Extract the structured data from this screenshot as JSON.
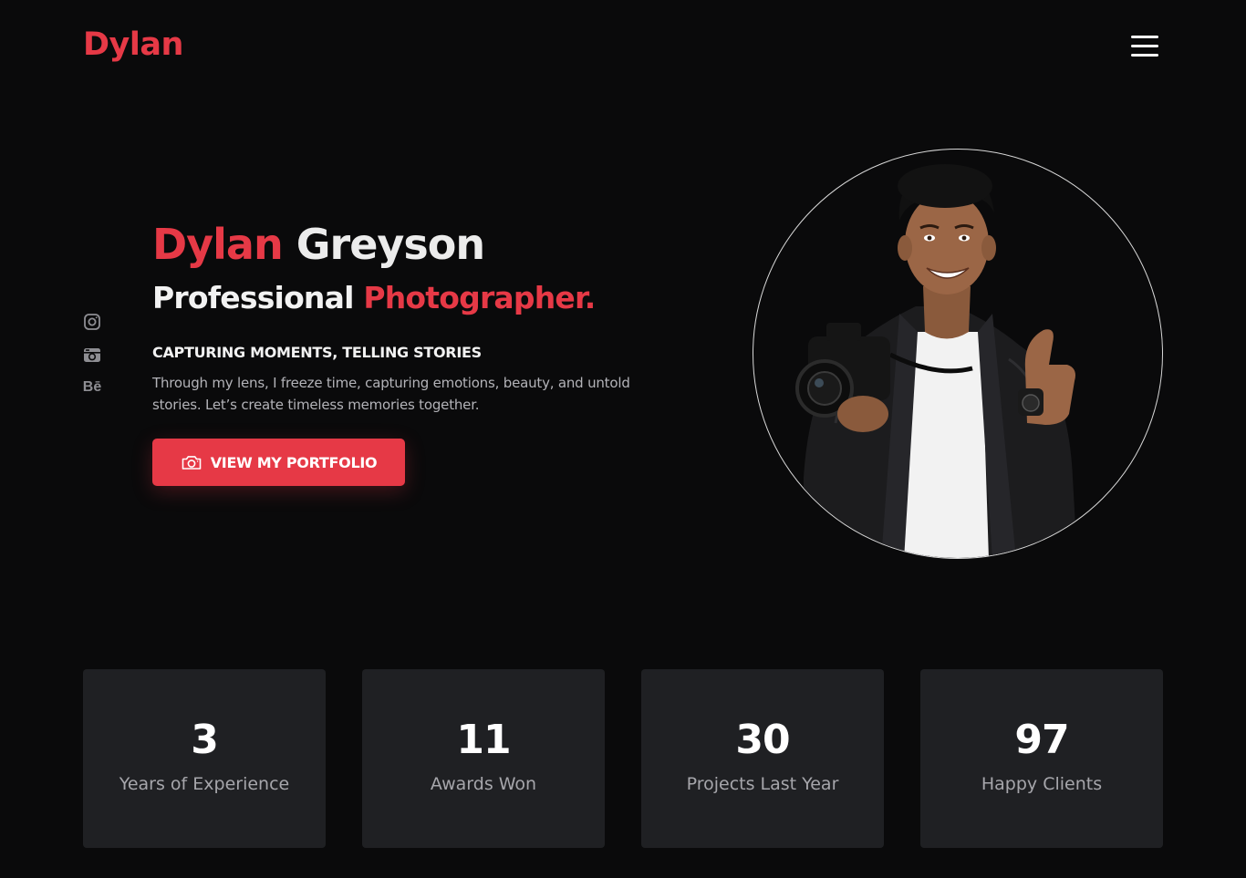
{
  "header": {
    "logo": "Dylan",
    "menu_icon": "hamburger-menu-icon"
  },
  "socials": [
    {
      "name": "instagram",
      "icon": "instagram-icon"
    },
    {
      "name": "flickr",
      "icon": "camera-retro-icon"
    },
    {
      "name": "behance",
      "icon": "behance-icon",
      "text": "Bē"
    }
  ],
  "hero": {
    "first_name": "Dylan",
    "last_name": "Greyson",
    "role_prefix": "Professional",
    "role_highlight": "Photographer.",
    "tagline": "CAPTURING MOMENTS, TELLING STORIES",
    "description": "Through my lens, I freeze time, capturing emotions, beauty, and untold stories. Let’s create timeless memories together.",
    "cta_label": "VIEW MY PORTFOLIO",
    "cta_icon": "camera-icon"
  },
  "portrait": {
    "alt": "Photographer holding a camera giving a thumbs up"
  },
  "stats": [
    {
      "value": "3",
      "label": "Years of Experience"
    },
    {
      "value": "11",
      "label": "Awards Won"
    },
    {
      "value": "30",
      "label": "Projects Last Year"
    },
    {
      "value": "97",
      "label": "Happy Clients"
    }
  ],
  "colors": {
    "accent": "#e63946",
    "background": "#0a0a0b",
    "card": "#1f2023",
    "muted": "#8e8e93"
  }
}
